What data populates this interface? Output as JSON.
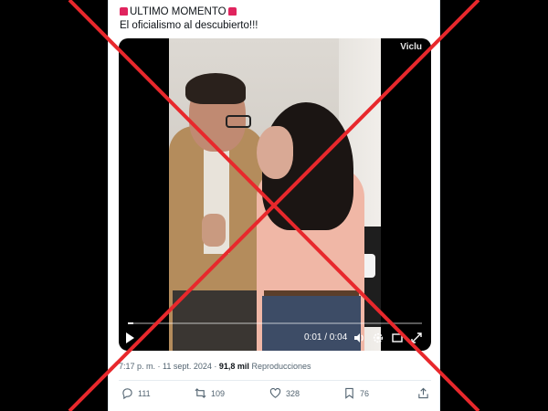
{
  "tweet": {
    "line1": "ULTIMO MOMENTO",
    "line2": "El oficialismo al descubierto!!!"
  },
  "video": {
    "watermark": "Viclu",
    "time": "0:01 / 0:04",
    "progress_fraction": 0.02
  },
  "meta": {
    "time_date": "7:17 p. m. · 11 sept. 2024 · ",
    "views_count": "91,8 mil",
    "views_label": " Reproducciones"
  },
  "actions": {
    "replies": "111",
    "reposts": "109",
    "likes": "328",
    "bookmarks": "76"
  },
  "colors": {
    "cross": "#e8282c",
    "siren": "#e0245e",
    "muted_text": "#536471"
  },
  "icons": [
    "siren-icon",
    "play-icon",
    "volume-icon",
    "settings-icon",
    "fullscreen-icon",
    "reply-icon",
    "repost-icon",
    "like-icon",
    "bookmark-icon",
    "share-icon"
  ]
}
